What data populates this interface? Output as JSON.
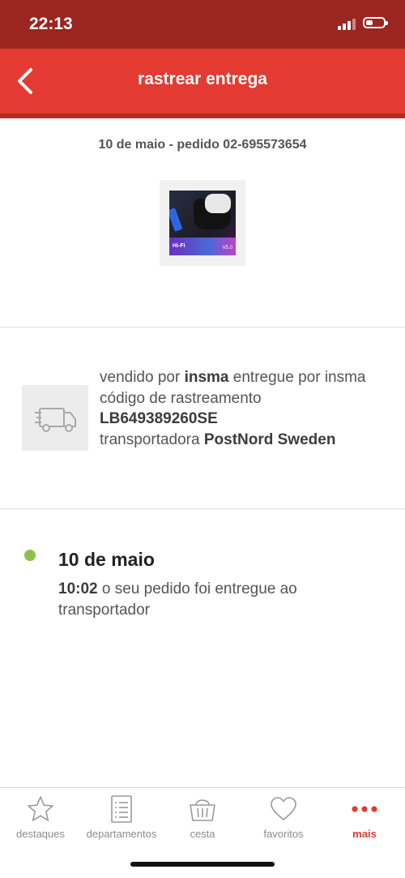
{
  "status_bar": {
    "time": "22:13",
    "signal_bars": 3,
    "battery_level": 0.4
  },
  "nav": {
    "title": "rastrear entrega",
    "back_icon": "chevron-left-icon"
  },
  "order": {
    "header": "10 de maio - pedido 02-695573654",
    "product_image_labels": {
      "hifi": "Hi-Fi",
      "version": "V5.0"
    }
  },
  "shipment": {
    "icon": "truck-icon",
    "sold_by_prefix": "vendido por",
    "seller": "insma",
    "delivered_by_prefix": "entregue por",
    "delivered_by": "insma",
    "tracking_label": "código de rastreamento",
    "tracking_code": "LB649389260SE",
    "carrier_prefix": "transportadora",
    "carrier": "PostNord Sweden"
  },
  "timeline": {
    "dot_color": "#8dc14b",
    "events": [
      {
        "date": "10 de maio",
        "time": "10:02",
        "description": "o seu pedido foi entregue ao transportador"
      }
    ]
  },
  "tab_bar": {
    "accent_color": "#e33a32",
    "tabs": [
      {
        "label": "destaques",
        "icon": "star-icon"
      },
      {
        "label": "departamentos",
        "icon": "list-icon"
      },
      {
        "label": "cesta",
        "icon": "basket-icon"
      },
      {
        "label": "favoritos",
        "icon": "heart-icon"
      },
      {
        "label": "mais",
        "icon": "more-dots-icon",
        "active": true
      }
    ]
  }
}
